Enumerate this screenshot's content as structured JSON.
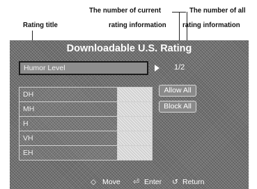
{
  "annotations": {
    "rating_title": "Rating title",
    "current_count_line1": "The number of current",
    "current_count_line2": "rating information",
    "all_count_line1": "The number of all",
    "all_count_line2": "rating information"
  },
  "screen": {
    "title": "Downloadable U.S. Rating",
    "rating_field": "Humor Level",
    "page_count": "1/2",
    "rows": [
      {
        "label": "DH"
      },
      {
        "label": "MH"
      },
      {
        "label": "H"
      },
      {
        "label": "VH"
      },
      {
        "label": "EH"
      }
    ],
    "allow_all": "Allow All",
    "block_all": "Block All",
    "footer": {
      "move_icon": "◇",
      "move": "Move",
      "enter_icon": "⏎",
      "enter": "Enter",
      "return_icon": "↺",
      "return": "Return"
    }
  }
}
